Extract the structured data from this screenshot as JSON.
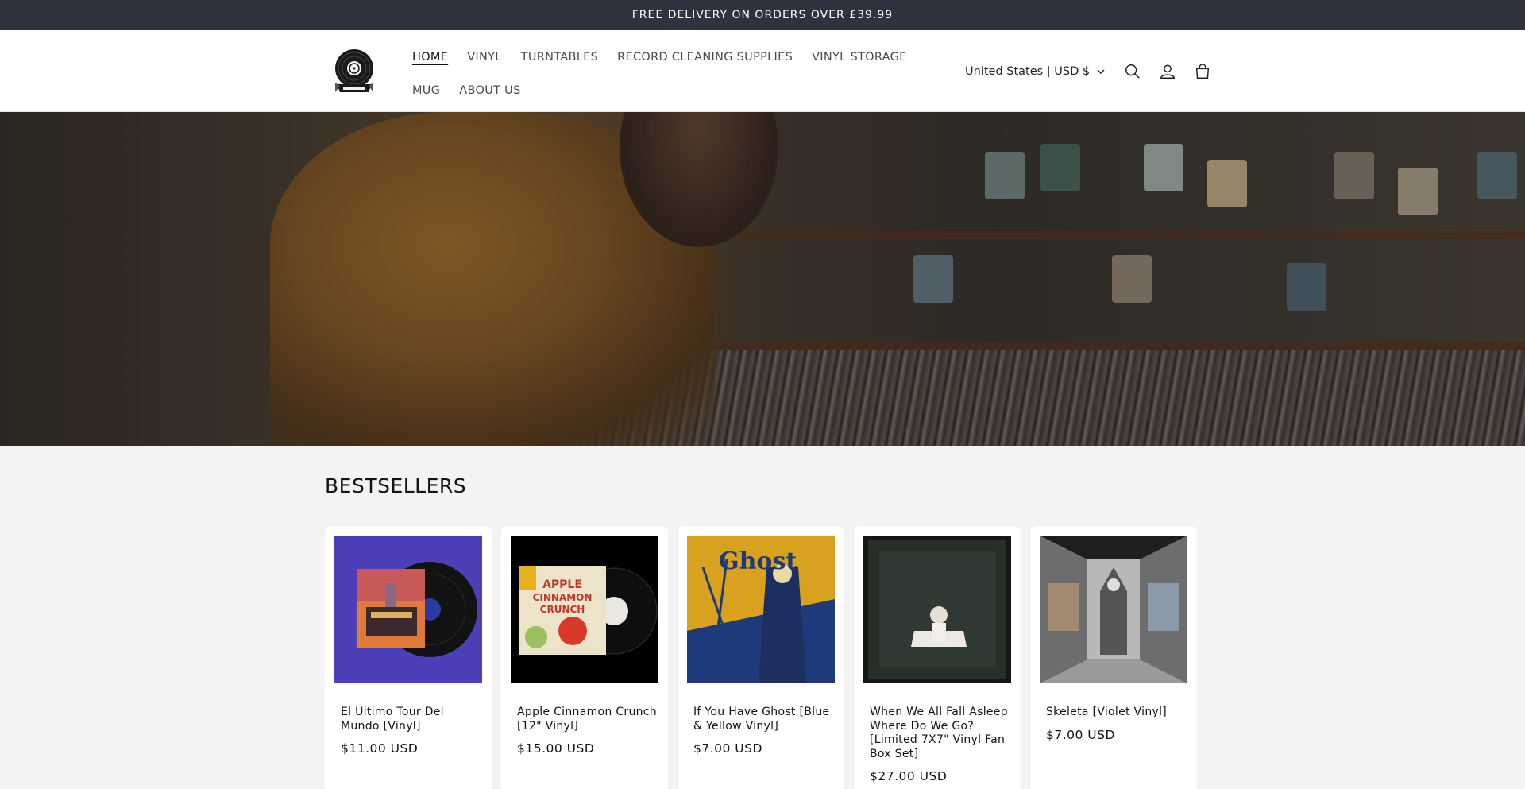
{
  "announcement": {
    "text": "FREE DELIVERY ON ORDERS OVER £39.99"
  },
  "header": {
    "logo_alt": "VINYL IS BACK",
    "nav": [
      {
        "label": "HOME",
        "active": true
      },
      {
        "label": "VINYL"
      },
      {
        "label": "TURNTABLES"
      },
      {
        "label": "RECORD CLEANING SUPPLIES"
      },
      {
        "label": "VINYL STORAGE"
      },
      {
        "label": "MUG"
      },
      {
        "label": "ABOUT US"
      }
    ],
    "country_selector": "United States | USD $",
    "icons": [
      "search-icon",
      "account-icon",
      "cart-icon"
    ]
  },
  "hero": {
    "image": "man-browsing-vinyl-records-in-store"
  },
  "bestsellers": {
    "title": "BESTSELLERS",
    "products": [
      {
        "title": "El Ultimo Tour Del Mundo [Vinyl]",
        "price": "$11.00 USD"
      },
      {
        "title": "Apple Cinnamon Crunch [12\" Vinyl]",
        "price": "$15.00 USD"
      },
      {
        "title": "If You Have Ghost [Blue & Yellow Vinyl]",
        "price": "$7.00 USD"
      },
      {
        "title": "When We All Fall Asleep Where Do We Go? [Limited 7X7\" Vinyl Fan Box Set]",
        "price": "$27.00 USD"
      },
      {
        "title": "Skeleta [Violet Vinyl]",
        "price": "$7.00 USD"
      }
    ]
  },
  "cover_text": {
    "apple": [
      "APPLE",
      "CINNAMON",
      "CRUNCH"
    ],
    "ghost": "Ghost"
  },
  "colors": {
    "announcement_bg": "#2f3340",
    "page_bg": "#f3f3f3",
    "card_bg": "#ffffff"
  }
}
